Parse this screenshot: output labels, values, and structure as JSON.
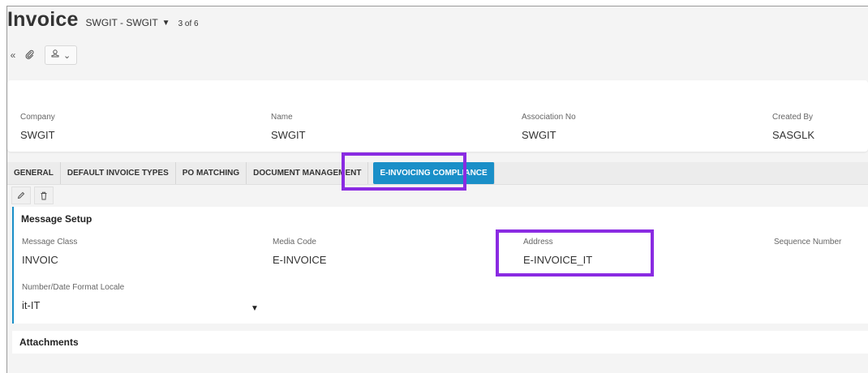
{
  "header": {
    "title": "Invoice",
    "context": "SWGIT - SWGIT",
    "counter": "3 of 6"
  },
  "toolbar": {
    "collapse_icon": "double-chevron-left-icon",
    "attach_icon": "paperclip-icon",
    "stamp_icon": "stamp-icon",
    "dropdown_icon": "chevron-down-icon"
  },
  "summary": {
    "fields": [
      {
        "label": "Company",
        "value": "SWGIT"
      },
      {
        "label": "Name",
        "value": "SWGIT"
      },
      {
        "label": "Association No",
        "value": "SWGIT"
      },
      {
        "label": "Created By",
        "value": "SASGLK"
      }
    ]
  },
  "tabs": [
    {
      "label": "GENERAL"
    },
    {
      "label": "DEFAULT INVOICE TYPES"
    },
    {
      "label": "PO MATCHING"
    },
    {
      "label": "DOCUMENT MANAGEMENT"
    },
    {
      "label": "E-INVOICING COMPLIANCE",
      "active": true
    }
  ],
  "message_setup": {
    "title": "Message Setup",
    "fields": [
      {
        "label": "Message Class",
        "value": "INVOIC"
      },
      {
        "label": "Media Code",
        "value": "E-INVOICE"
      },
      {
        "label": "Address",
        "value": "E-INVOICE_IT"
      },
      {
        "label": "Sequence Number",
        "value": ""
      }
    ],
    "locale_label": "Number/Date Format Locale",
    "locale_value": "it-IT"
  },
  "attachments": {
    "title": "Attachments"
  },
  "colors": {
    "accent": "#1a8fc8",
    "highlight": "#8a2be2"
  }
}
